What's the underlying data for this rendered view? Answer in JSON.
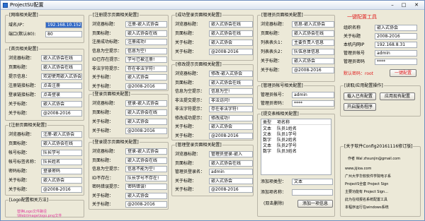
{
  "window": {
    "title": "ProjectSU配置",
    "minimize": "–",
    "maximize": "□",
    "close": "✕"
  },
  "g_net": {
    "title": "[网络相关配置]",
    "rows": [
      {
        "label": "域名/IP：",
        "value": "192.168.10.152"
      },
      {
        "label": "端口(默认80):",
        "value": "80"
      }
    ]
  },
  "g_home": {
    "title": "[首页相关配置]",
    "rows": [
      {
        "label": "浏览器标题：",
        "value": "嵌入式协会在线"
      },
      {
        "label": "页面标题：",
        "value": "嵌入式协会在线"
      },
      {
        "label": "提示信息：",
        "value": "欢迎使用嵌入式协会"
      },
      {
        "label": "注册链接标题：",
        "value": "点击注册"
      },
      {
        "label": "登录链接标题：",
        "value": "点击登录"
      },
      {
        "label": "关于标题：",
        "value": "嵌入式协会"
      },
      {
        "label": "关于标题：",
        "value": "@2008-2016"
      }
    ]
  },
  "g_reg": {
    "title": "[注册页面相关配置]",
    "rows": [
      {
        "label": "浏览器标题：",
        "value": "注册-嵌入式协会"
      },
      {
        "label": "页面标题：",
        "value": "嵌入式协会在线"
      },
      {
        "label": "帐号标题：",
        "value": "队长学号"
      },
      {
        "label": "帐号标签名称：",
        "value": "队长姓名"
      },
      {
        "label": "密码标题：",
        "value": "登录密码"
      },
      {
        "label": "关于标题：",
        "value": "嵌入式协会"
      },
      {
        "label": "关于标题：",
        "value": "@2008-2016"
      }
    ]
  },
  "g_logo": {
    "title": "[Logo配置相关方法]",
    "note": "替换Logo文件路径 \\Web\\Image\\logo.png文件"
  },
  "g_regok": {
    "title": "[注册提示页面相关配置]",
    "rows": [
      {
        "label": "浏览器标题：",
        "value": "注册-嵌入式协会"
      },
      {
        "label": "页面标题：",
        "value": "嵌入式协会在线"
      },
      {
        "label": "注册成功标题：",
        "value": "注册成功!"
      },
      {
        "label": "信息为空提示：",
        "value": "信息为空!"
      },
      {
        "label": "ID已存在提示：",
        "value": "学号已被注册!"
      },
      {
        "label": "非法字符提示：",
        "value": "存在非法字符!"
      },
      {
        "label": "关于标题：",
        "value": "嵌入式协会"
      },
      {
        "label": "关于标题：",
        "value": "@2008-2016"
      }
    ]
  },
  "g_login": {
    "title": "[登录页面相关配置]",
    "rows": [
      {
        "label": "浏览器标题：",
        "value": "登录-嵌入式协会"
      },
      {
        "label": "页面标题：",
        "value": "嵌入式协会在线"
      },
      {
        "label": "关于标题：",
        "value": "嵌入式协会"
      },
      {
        "label": "关于标题：",
        "value": "@2008-2016"
      }
    ]
  },
  "g_loginok": {
    "title": "[登录提示页面相关配置]",
    "rows": [
      {
        "label": "浏览器标题：",
        "value": "登录-嵌入式协会"
      },
      {
        "label": "页面标题：",
        "value": "嵌入式协会在线"
      },
      {
        "label": "信息为空提示：",
        "value": "信息不能为空!"
      },
      {
        "label": "ID不存在：",
        "value": "队长学号不存在!"
      },
      {
        "label": "密码错误提示：",
        "value": "密码错误!"
      },
      {
        "label": "关于标题：",
        "value": "嵌入式协会"
      },
      {
        "label": "关于标题：",
        "value": "@2008-2016"
      }
    ]
  },
  "g_success": {
    "title": "[成功登录页面相关配置]",
    "rows": [
      {
        "label": "浏览器标题：",
        "value": "嵌入式协会在线"
      },
      {
        "label": "页面标题：",
        "value": "嵌入式协会在线"
      },
      {
        "label": "关于标题：",
        "value": "嵌入式协会"
      },
      {
        "label": "关于标题：",
        "value": "@2008-2016"
      }
    ]
  },
  "g_modify": {
    "title": "[修改提示页面相关配置]",
    "rows": [
      {
        "label": "浏览器标题：",
        "value": "修改-嵌入式协会"
      },
      {
        "label": "页面标题：",
        "value": "嵌入式协会在线"
      },
      {
        "label": "信息为空提示：",
        "value": "信息为空!"
      },
      {
        "label": "非法提交提示：",
        "value": "非法访问!"
      },
      {
        "label": "非法字符提示：",
        "value": "存在非法字符!"
      },
      {
        "label": "修改成功提示：",
        "value": "修改成功!"
      },
      {
        "label": "关于标题：",
        "value": "嵌入式协会"
      },
      {
        "label": "关于标题：",
        "value": "@2008-2016"
      }
    ]
  },
  "g_admlogin": {
    "title": "[管理登录页面相关配置]",
    "rows": [
      {
        "label": "浏览器标题：",
        "value": "管理员登录-嵌入"
      },
      {
        "label": "页面标题：",
        "value": "嵌入式协会在线"
      },
      {
        "label": "管理员登录名：",
        "value": "admin"
      },
      {
        "label": "关于标题：",
        "value": "嵌入式协会"
      },
      {
        "label": "关于标题：",
        "value": "@2008-2016"
      }
    ]
  },
  "g_admpage": {
    "title": "[管理员页面相关配置]",
    "rows": [
      {
        "label": "浏览器标题：",
        "value": "信息-嵌入式协会"
      },
      {
        "label": "页面标题：",
        "value": "嵌入式协会在线"
      },
      {
        "label": "列表表头1：",
        "value": "主要负责人信息"
      },
      {
        "label": "列表表头2：",
        "value": "队伍总体信息"
      },
      {
        "label": "关于标题：",
        "value": "嵌入式协会"
      },
      {
        "label": "关于标题：",
        "value": "@2008-2016"
      }
    ]
  },
  "g_admacct": {
    "title": "[管理员帐号相关配置]",
    "rows": [
      {
        "label": "管理员帐号：",
        "value": "admin"
      },
      {
        "label": "管理员密码：",
        "value": "****"
      }
    ]
  },
  "g_table": {
    "title": "[提交表格相关配置]",
    "headers": [
      "类型",
      "项名称"
    ],
    "items": [
      {
        "type": "文本",
        "name": "队员1姓名"
      },
      {
        "type": "文本",
        "name": "队员1学号"
      },
      {
        "type": "数字",
        "name": "队员2姓名"
      },
      {
        "type": "文本",
        "name": "队员2学号"
      },
      {
        "type": "数字",
        "name": "队员3姓名"
      }
    ],
    "add_type_label": "添加项类型：",
    "add_type_value": "文本",
    "add_name_label": "添加项名称：",
    "add_name_value": "",
    "dblclick_delete": "(双击删除)",
    "add_button": "添加一项信息"
  },
  "g_right": {
    "tool_title": "一键配置工具",
    "rows": [
      {
        "label": "组织名称",
        "value": "嵌入式协会"
      },
      {
        "label": "关于标题",
        "value": "2008-2016"
      },
      {
        "label": "本机内网IP",
        "value": "192.168.8.31"
      },
      {
        "label": "管理员帐号",
        "value": "admin"
      },
      {
        "label": "管理员密码",
        "value": "****"
      }
    ],
    "default_pw": "默认密码：root",
    "one_click": "一键配置"
  },
  "g_ops": {
    "title": "[读取/应用配置操作]",
    "read": "载入已有配置",
    "apply": "应用现有配置",
    "start": "开启服务程序"
  },
  "g_about": {
    "title": "[关于软件Config20161116修订版]",
    "lines": [
      "作者 Wal zhsunjin@gmail.com",
      "www.jijioa.com",
      "广州大学华软软件学院电子系",
      "ProjectS全套 Project Sign",
      "主要功能有 Project Sign...",
      "此为在线报名系统配置工具",
      "本程序运行在windows系统"
    ]
  }
}
